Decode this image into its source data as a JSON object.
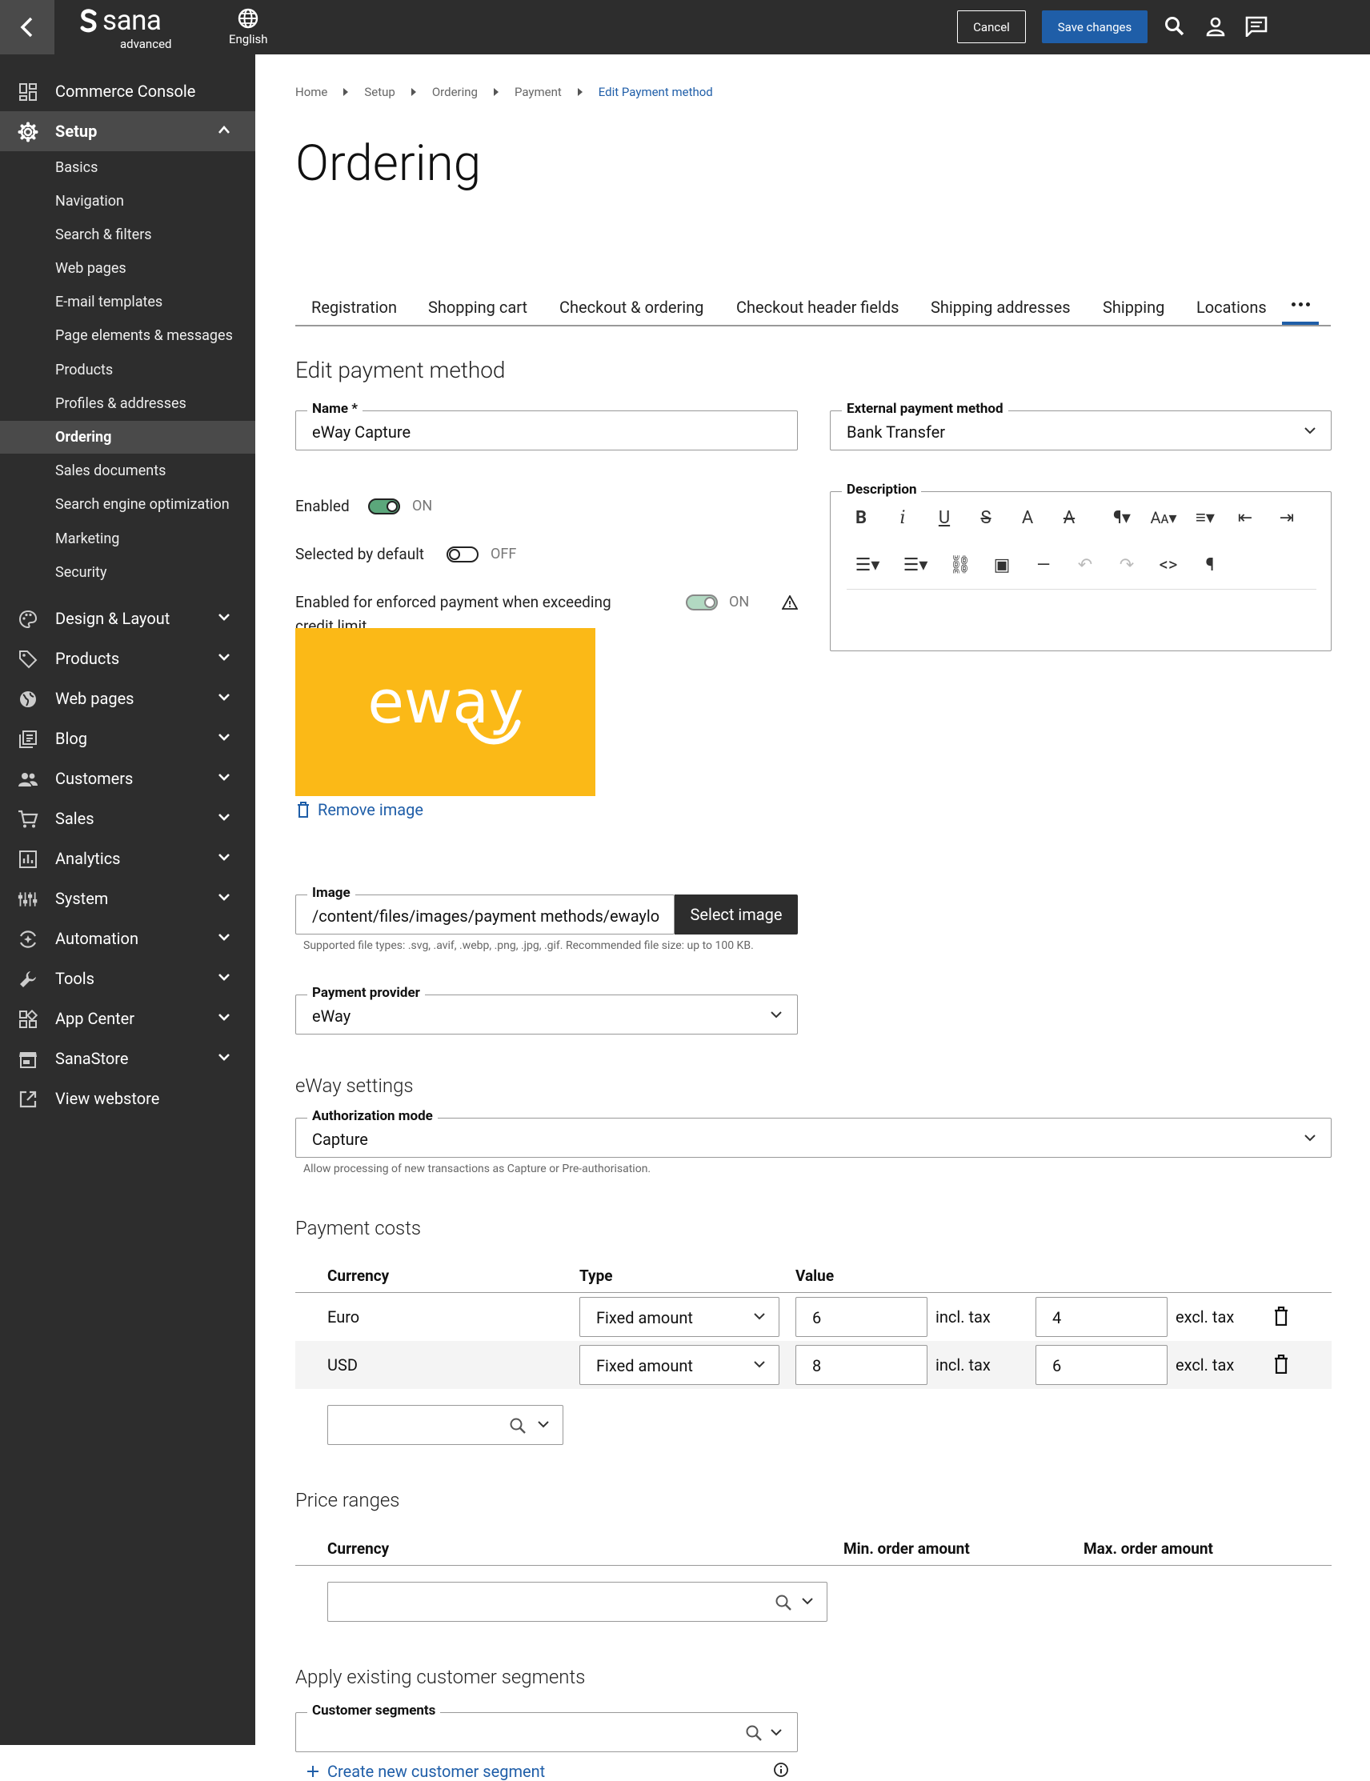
{
  "topbar": {
    "logo_word": "sana",
    "logo_sub": "advanced",
    "language": "English",
    "cancel_label": "Cancel",
    "save_label": "Save changes"
  },
  "sidebar": {
    "items": [
      {
        "label": "Commerce Console",
        "icon": "dashboard-icon"
      },
      {
        "label": "Setup",
        "icon": "gear-icon",
        "expanded": true,
        "children": [
          "Basics",
          "Navigation",
          "Search & filters",
          "Web pages",
          "E-mail templates",
          "Page elements & messages",
          "Products",
          "Profiles & addresses",
          "Ordering",
          "Sales documents",
          "Search engine optimization",
          "Marketing",
          "Security"
        ],
        "active_child": "Ordering"
      },
      {
        "label": "Design & Layout",
        "icon": "palette-icon"
      },
      {
        "label": "Products",
        "icon": "tag-icon"
      },
      {
        "label": "Web pages",
        "icon": "globe-icon"
      },
      {
        "label": "Blog",
        "icon": "blog-icon"
      },
      {
        "label": "Customers",
        "icon": "people-icon"
      },
      {
        "label": "Sales",
        "icon": "cart-icon"
      },
      {
        "label": "Analytics",
        "icon": "chart-icon"
      },
      {
        "label": "System",
        "icon": "sliders-icon"
      },
      {
        "label": "Automation",
        "icon": "automation-icon"
      },
      {
        "label": "Tools",
        "icon": "wrench-icon"
      },
      {
        "label": "App Center",
        "icon": "apps-icon"
      },
      {
        "label": "SanaStore",
        "icon": "store-icon"
      },
      {
        "label": "View webstore",
        "icon": "external-link-icon"
      }
    ]
  },
  "breadcrumb": [
    "Home",
    "Setup",
    "Ordering",
    "Payment",
    "Edit Payment method"
  ],
  "page_title": "Ordering",
  "tabs": [
    "Registration",
    "Shopping cart",
    "Checkout & ordering",
    "Checkout header fields",
    "Shipping addresses",
    "Shipping",
    "Locations"
  ],
  "form": {
    "section_title": "Edit payment method",
    "name": {
      "label": "Name *",
      "value": "eWay Capture"
    },
    "external_method": {
      "label": "External payment method",
      "value": "Bank Transfer"
    },
    "enabled": {
      "label": "Enabled",
      "state": "ON"
    },
    "selected_default": {
      "label": "Selected by default",
      "state": "OFF"
    },
    "enforced": {
      "label_line1": "Enabled for enforced payment when exceeding",
      "label_line2": "credit limit",
      "state": "ON"
    },
    "description_label": "Description",
    "logo_text": "eway",
    "remove_image": "Remove image",
    "image": {
      "label": "Image",
      "value": "/content/files/images/payment methods/ewaylo",
      "button": "Select image",
      "hint": "Supported file types: .svg, .avif, .webp, .png, .jpg, .gif. Recommended file size: up to 100 KB."
    },
    "provider": {
      "label": "Payment provider",
      "value": "eWay"
    }
  },
  "eway_settings": {
    "title": "eWay settings",
    "auth_mode": {
      "label": "Authorization mode",
      "value": "Capture",
      "hint": "Allow processing of new transactions as Capture or Pre-authorisation."
    }
  },
  "payment_costs": {
    "title": "Payment costs",
    "headers": [
      "Currency",
      "Type",
      "Value"
    ],
    "incl_label": "incl. tax",
    "excl_label": "excl. tax",
    "rows": [
      {
        "currency": "Euro",
        "type": "Fixed amount",
        "incl": "6",
        "excl": "4"
      },
      {
        "currency": "USD",
        "type": "Fixed amount",
        "incl": "8",
        "excl": "6"
      }
    ]
  },
  "price_ranges": {
    "title": "Price ranges",
    "headers": [
      "Currency",
      "Min. order amount",
      "Max. order amount"
    ]
  },
  "segments": {
    "title": "Apply existing customer segments",
    "field_label": "Customer segments",
    "create_link": "Create new customer segment"
  },
  "colors": {
    "accent": "#1f5ea8",
    "sidebar": "#2d2d2d",
    "toggle_on": "#5ba77b",
    "logo_bg": "#fbb917"
  }
}
